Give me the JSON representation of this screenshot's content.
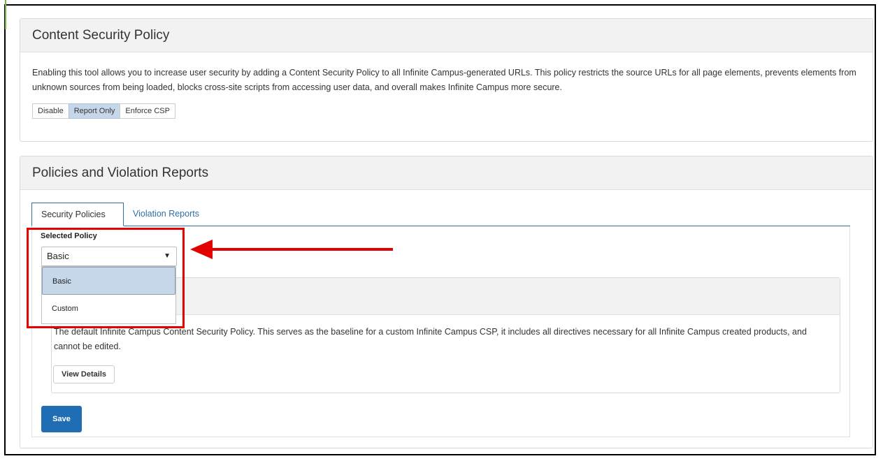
{
  "csp": {
    "title": "Content Security Policy",
    "description": "Enabling this tool allows you to increase user security by adding a Content Security Policy to all Infinite Campus-generated URLs. This policy restricts the source URLs for all page elements, prevents elements from unknown sources from being loaded, blocks cross-site scripts from accessing user data, and overall makes Infinite Campus more secure.",
    "modes": [
      "Disable",
      "Report Only",
      "Enforce CSP"
    ],
    "active_mode": "Report Only"
  },
  "policies": {
    "title": "Policies and Violation Reports",
    "tabs": [
      "Security Policies",
      "Violation Reports"
    ],
    "active_tab": "Security Policies",
    "selected_policy_label": "Selected Policy",
    "selected_policy_value": "Basic",
    "options": [
      "Basic",
      "Custom"
    ],
    "policy_description": "The default Infinite Campus Content Security Policy. This serves as the baseline for a custom Infinite Campus CSP, it includes all directives necessary for all Infinite Campus created products, and cannot be edited.",
    "view_details_label": "View Details",
    "save_label": "Save"
  },
  "colors": {
    "accent": "#1f6eb5",
    "selected_bg": "#c6d7e9",
    "annotation_red": "#e30000"
  }
}
